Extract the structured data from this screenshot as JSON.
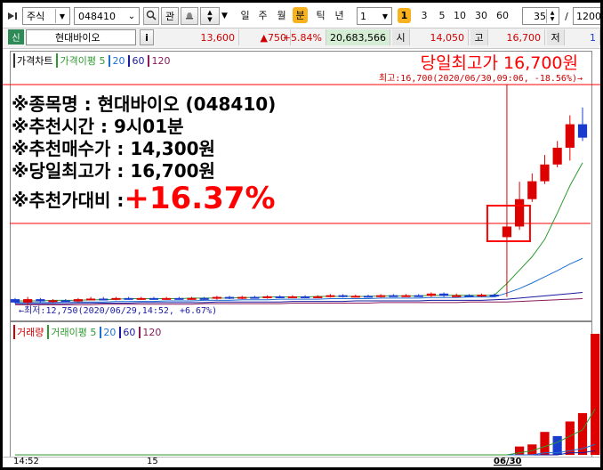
{
  "toolbar": {
    "market": "주식",
    "code": "048410",
    "lookup_label": "관",
    "periods": [
      "일",
      "주",
      "월",
      "분",
      "틱",
      "년"
    ],
    "active_period": "분",
    "interval_value": "1",
    "interval_badge": "1",
    "intervals": [
      "3",
      "5",
      "10",
      "30",
      "60"
    ],
    "count_value": "35",
    "slash": "/",
    "max_value": "1200"
  },
  "quote": {
    "tag": "신",
    "name": "현대바이오",
    "info": "i",
    "price": "13,600",
    "change": "▲750",
    "change_pct": "+5.84%",
    "volume": "20,683,566",
    "open_label": "시",
    "open": "14,050",
    "high_label": "고",
    "high": "16,700",
    "low_label": "저",
    "low": "1"
  },
  "price_panel": {
    "legend": [
      {
        "text": "가격차트",
        "color": "#000000"
      },
      {
        "text": "가격이평 5",
        "color": "#2e9a2e"
      },
      {
        "text": "20",
        "color": "#1f6fd1"
      },
      {
        "text": "60",
        "color": "#1a1aa0"
      },
      {
        "text": "120",
        "color": "#8a1a5a"
      }
    ],
    "headline": "당일최고가 16,700원",
    "high_marker": "최고:16,700(2020/06/30,09:06, -18.56%)→",
    "low_marker": "←최저:12,750(2020/06/29,14:52, +6.67%)"
  },
  "overlay": {
    "line1": "※종목명 : 현대바이오 (048410)",
    "line2": "※추천시간 : 9시01분",
    "line3": "※추천매수가 : 14,300원",
    "line4": "※당일최고가 : 16,700원",
    "line5_prefix": "※추천가대비 : ",
    "line5_value": "+16.37%"
  },
  "volume_panel": {
    "legend": [
      {
        "text": "거래량",
        "color": "#cc0000"
      },
      {
        "text": "거래이평 5",
        "color": "#2e9a2e"
      },
      {
        "text": "20",
        "color": "#1f6fd1"
      },
      {
        "text": "60",
        "color": "#1a1aa0"
      },
      {
        "text": "120",
        "color": "#8a1a5a"
      }
    ]
  },
  "xaxis": [
    "14:52",
    "15",
    "06/30"
  ],
  "colors": {
    "up": "#dd0000",
    "down": "#1a3ccc",
    "accent": "#ff0000"
  },
  "chart_data": {
    "type": "candlestick",
    "y_axis_range": [
      12750,
      16700
    ],
    "candles": [
      {
        "open": 12860,
        "close": 12800,
        "high": 12880,
        "low": 12780
      },
      {
        "open": 12800,
        "close": 12860,
        "high": 12900,
        "low": 12760
      },
      {
        "open": 12860,
        "close": 12820,
        "high": 12880,
        "low": 12800
      },
      {
        "open": 12820,
        "close": 12840,
        "high": 12860,
        "low": 12800
      },
      {
        "open": 12840,
        "close": 12820,
        "high": 12860,
        "low": 12800
      },
      {
        "open": 12820,
        "close": 12860,
        "high": 12880,
        "low": 12800
      },
      {
        "open": 12860,
        "close": 12870,
        "high": 12900,
        "low": 12840
      },
      {
        "open": 12870,
        "close": 12860,
        "high": 12900,
        "low": 12840
      },
      {
        "open": 12860,
        "close": 12880,
        "high": 12900,
        "low": 12840
      },
      {
        "open": 12880,
        "close": 12870,
        "high": 12900,
        "low": 12850
      },
      {
        "open": 12870,
        "close": 12880,
        "high": 12900,
        "low": 12850
      },
      {
        "open": 12880,
        "close": 12870,
        "high": 12900,
        "low": 12850
      },
      {
        "open": 12870,
        "close": 12880,
        "high": 12900,
        "low": 12850
      },
      {
        "open": 12880,
        "close": 12870,
        "high": 12900,
        "low": 12850
      },
      {
        "open": 12870,
        "close": 12880,
        "high": 12900,
        "low": 12850
      },
      {
        "open": 12880,
        "close": 12870,
        "high": 12900,
        "low": 12850
      },
      {
        "open": 12870,
        "close": 12900,
        "high": 12920,
        "low": 12850
      },
      {
        "open": 12900,
        "close": 12880,
        "high": 12920,
        "low": 12860
      },
      {
        "open": 12880,
        "close": 12900,
        "high": 12920,
        "low": 12860
      },
      {
        "open": 12900,
        "close": 12890,
        "high": 12920,
        "low": 12870
      },
      {
        "open": 12890,
        "close": 12910,
        "high": 12930,
        "low": 12870
      },
      {
        "open": 12910,
        "close": 12900,
        "high": 12930,
        "low": 12880
      },
      {
        "open": 12900,
        "close": 12910,
        "high": 12930,
        "low": 12880
      },
      {
        "open": 12910,
        "close": 12900,
        "high": 12930,
        "low": 12880
      },
      {
        "open": 12900,
        "close": 12910,
        "high": 12930,
        "low": 12880
      },
      {
        "open": 12910,
        "close": 12930,
        "high": 12950,
        "low": 12890
      },
      {
        "open": 12930,
        "close": 12900,
        "high": 12950,
        "low": 12890
      },
      {
        "open": 12900,
        "close": 12920,
        "high": 12940,
        "low": 12890
      },
      {
        "open": 12920,
        "close": 12910,
        "high": 12940,
        "low": 12890
      },
      {
        "open": 12910,
        "close": 12930,
        "high": 12950,
        "low": 12890
      },
      {
        "open": 12930,
        "close": 12920,
        "high": 12950,
        "low": 12900
      },
      {
        "open": 12920,
        "close": 12930,
        "high": 12950,
        "low": 12900
      },
      {
        "open": 12930,
        "close": 12920,
        "high": 12950,
        "low": 12900
      },
      {
        "open": 12920,
        "close": 12960,
        "high": 12980,
        "low": 12900
      },
      {
        "open": 12960,
        "close": 12920,
        "high": 12980,
        "low": 12900
      },
      {
        "open": 12920,
        "close": 12930,
        "high": 12960,
        "low": 12900
      },
      {
        "open": 12930,
        "close": 12920,
        "high": 12950,
        "low": 12900
      },
      {
        "open": 12920,
        "close": 12940,
        "high": 12960,
        "low": 12900
      },
      {
        "open": 12940,
        "close": 12930,
        "high": 12960,
        "low": 12910
      },
      {
        "open": 13970,
        "close": 14160,
        "high": 16700,
        "low": 12900
      },
      {
        "open": 14160,
        "close": 14650,
        "high": 14960,
        "low": 14100
      },
      {
        "open": 14650,
        "close": 14970,
        "high": 15110,
        "low": 14600
      },
      {
        "open": 14970,
        "close": 15270,
        "high": 15440,
        "low": 14920
      },
      {
        "open": 15270,
        "close": 15570,
        "high": 15690,
        "low": 15220
      },
      {
        "open": 15570,
        "close": 15990,
        "high": 16150,
        "low": 15340
      },
      {
        "open": 15990,
        "close": 15750,
        "high": 16290,
        "low": 15690
      }
    ],
    "ma5": [
      12830,
      12830,
      12830,
      12840,
      12840,
      12840,
      12850,
      12850,
      12860,
      12870,
      12870,
      12870,
      12870,
      12870,
      12880,
      12880,
      12880,
      12880,
      12890,
      12890,
      12900,
      12900,
      12900,
      12900,
      12910,
      12910,
      12910,
      12910,
      12910,
      12920,
      12920,
      12920,
      12920,
      12930,
      12930,
      12930,
      12930,
      12930,
      12930,
      13140,
      13380,
      13620,
      13930,
      14400,
      14890,
      15300
    ],
    "ma20": [
      12800,
      12800,
      12800,
      12800,
      12810,
      12810,
      12810,
      12810,
      12820,
      12820,
      12820,
      12820,
      12830,
      12830,
      12830,
      12840,
      12840,
      12840,
      12850,
      12850,
      12850,
      12860,
      12860,
      12860,
      12860,
      12870,
      12870,
      12870,
      12870,
      12880,
      12880,
      12880,
      12880,
      12890,
      12890,
      12890,
      12900,
      12900,
      12900,
      12970,
      13050,
      13150,
      13260,
      13370,
      13490,
      13590
    ],
    "ma60": [
      12780,
      12780,
      12780,
      12780,
      12780,
      12790,
      12790,
      12790,
      12790,
      12790,
      12800,
      12800,
      12800,
      12800,
      12800,
      12800,
      12810,
      12810,
      12810,
      12810,
      12810,
      12810,
      12820,
      12820,
      12820,
      12820,
      12820,
      12830,
      12830,
      12830,
      12830,
      12830,
      12830,
      12840,
      12840,
      12840,
      12840,
      12840,
      12850,
      12860,
      12880,
      12900,
      12920,
      12940,
      12960,
      12980
    ],
    "ma120": [
      12760,
      12760,
      12760,
      12760,
      12760,
      12760,
      12760,
      12770,
      12770,
      12770,
      12770,
      12770,
      12770,
      12770,
      12770,
      12780,
      12780,
      12780,
      12780,
      12780,
      12780,
      12780,
      12790,
      12790,
      12790,
      12790,
      12790,
      12790,
      12790,
      12800,
      12800,
      12800,
      12800,
      12800,
      12800,
      12800,
      12810,
      12810,
      12810,
      12810,
      12820,
      12830,
      12840,
      12850,
      12860,
      12870
    ],
    "volume": [
      0,
      0,
      0,
      0,
      0,
      0,
      0,
      0,
      0,
      0,
      0,
      0,
      0,
      0,
      0,
      0,
      0,
      0,
      0,
      0,
      0,
      0,
      0,
      0,
      0,
      0,
      0,
      0,
      0,
      0,
      0,
      0,
      0,
      0,
      0,
      0,
      0,
      0,
      0,
      0,
      4,
      5,
      11,
      9,
      16,
      20,
      58
    ],
    "volume_color": [
      "up",
      "up",
      "up",
      "up",
      "up",
      "up",
      "up",
      "up",
      "up",
      "up",
      "up",
      "up",
      "up",
      "up",
      "up",
      "up",
      "up",
      "up",
      "up",
      "up",
      "up",
      "up",
      "up",
      "up",
      "up",
      "up",
      "up",
      "up",
      "up",
      "up",
      "up",
      "up",
      "up",
      "up",
      "up",
      "up",
      "up",
      "up",
      "up",
      "up",
      "up",
      "up",
      "up",
      "down",
      "up",
      "up",
      "up"
    ],
    "volume_ma5": [
      0,
      0,
      0,
      0,
      0,
      0,
      0,
      0,
      0,
      0,
      0,
      0,
      0,
      0,
      0,
      0,
      0,
      0,
      0,
      0,
      0,
      0,
      0,
      0,
      0,
      0,
      0,
      0,
      0,
      0,
      0,
      0,
      0,
      0,
      0,
      0,
      0,
      0,
      0,
      0,
      1,
      2,
      4,
      6,
      9,
      12,
      22
    ],
    "volume_ma20": [
      0,
      0,
      0,
      0,
      0,
      0,
      0,
      0,
      0,
      0,
      0,
      0,
      0,
      0,
      0,
      0,
      0,
      0,
      0,
      0,
      0,
      0,
      0,
      0,
      0,
      0,
      0,
      0,
      0,
      0,
      0,
      0,
      0,
      0,
      0,
      0,
      0,
      0,
      0,
      0,
      0,
      0,
      1,
      1,
      2,
      3,
      5
    ],
    "volume_ma60": [
      0,
      0,
      0,
      0,
      0,
      0,
      0,
      0,
      0,
      0,
      0,
      0,
      0,
      0,
      0,
      0,
      0,
      0,
      0,
      0,
      0,
      0,
      0,
      0,
      0,
      0,
      0,
      0,
      0,
      0,
      0,
      0,
      0,
      0,
      0,
      0,
      0,
      0,
      0,
      0,
      0,
      0,
      0,
      0,
      1,
      1,
      2
    ]
  }
}
